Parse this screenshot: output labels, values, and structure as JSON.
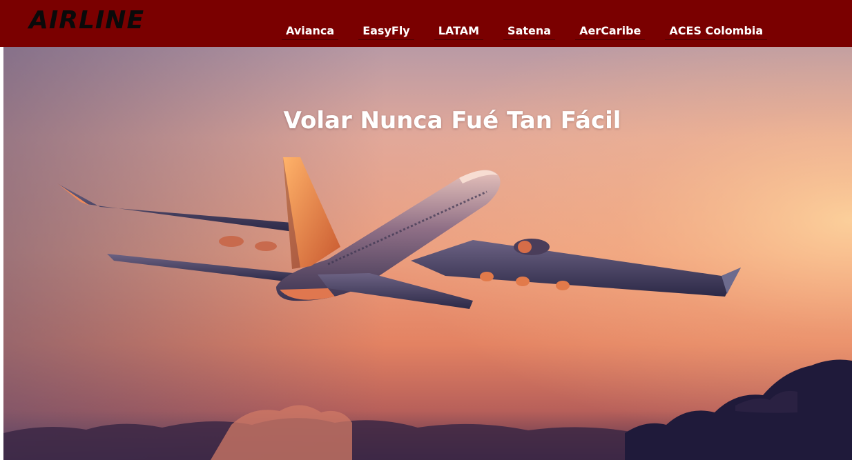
{
  "brand": {
    "logo_text": "AIRLINE"
  },
  "nav": {
    "items": [
      {
        "label": "Avianca"
      },
      {
        "label": "EasyFly"
      },
      {
        "label": "LATAM"
      },
      {
        "label": "Satena"
      },
      {
        "label": "AerCaribe"
      },
      {
        "label": "ACES Colombia"
      }
    ]
  },
  "hero": {
    "title": "Volar Nunca Fué Tan Fácil",
    "image": "airplane-sunset-photo"
  },
  "colors": {
    "navbar_bg": "#7a0000",
    "logo_text": "#0a0a0a",
    "nav_text": "#ffffff",
    "hero_title": "#ffffff"
  }
}
